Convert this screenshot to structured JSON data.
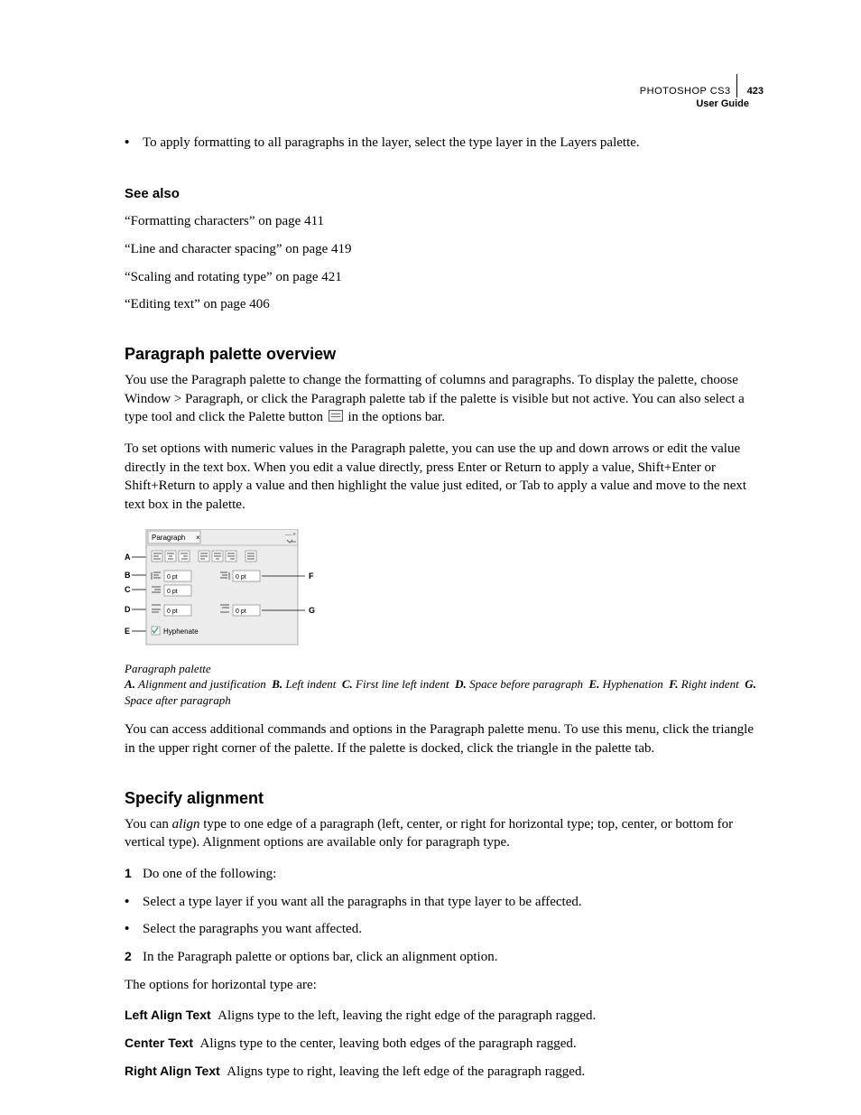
{
  "header": {
    "product": "PHOTOSHOP CS3",
    "page_number": "423",
    "guide": "User Guide"
  },
  "intro_bullet": "To apply formatting to all paragraphs in the layer, select the type layer in the Layers palette.",
  "see_also": {
    "heading": "See also",
    "items": [
      "“Formatting characters” on page 411",
      "“Line and character spacing” on page 419",
      "“Scaling and rotating type” on page 421",
      "“Editing text” on page 406"
    ]
  },
  "overview": {
    "heading": "Paragraph palette overview",
    "p1a": "You use the Paragraph palette to change the formatting of columns and paragraphs. To display the palette, choose Window > Paragraph, or click the Paragraph palette tab if the palette is visible but not active. You can also select a type tool and click the Palette button ",
    "p1b": " in the options bar.",
    "p2": "To set options with numeric values in the Paragraph palette, you can use the up and down arrows or edit the value directly in the text box. When you edit a value directly, press Enter or Return to apply a value, Shift+Enter or Shift+Return to apply a value and then highlight the value just edited, or Tab to apply a value and move to the next text box in the palette."
  },
  "figure": {
    "tab_label": "Paragraph",
    "field_value": "0 pt",
    "hyphenate": "Hyphenate",
    "labels": {
      "A": "A",
      "B": "B",
      "C": "C",
      "D": "D",
      "E": "E",
      "F": "F",
      "G": "G"
    },
    "caption_title": "Paragraph palette",
    "caption_parts": {
      "A": "Alignment and justification",
      "B": "Left indent",
      "C": "First line left indent",
      "D": "Space before paragraph",
      "E": "Hyphenation",
      "F": "Right indent",
      "G": "Space after paragraph"
    }
  },
  "after_figure": "You can access additional commands and options in the Paragraph palette menu. To use this menu, click the triangle in the upper right corner of the palette. If the palette is docked, click the triangle in the palette tab.",
  "specify": {
    "heading": "Specify alignment",
    "p1a": "You can ",
    "p1_em": "align",
    "p1b": " type to one edge of a paragraph (left, center, or right for horizontal type; top, center, or bottom for vertical type). Alignment options are available only for paragraph type.",
    "step1": "Do one of the following:",
    "step1_bullets": [
      "Select a type layer if you want all the paragraphs in that type layer to be affected.",
      "Select the paragraphs you want affected."
    ],
    "step2": "In the Paragraph palette or options bar, click an alignment option.",
    "options_intro": "The options for horizontal type are:",
    "definitions": [
      {
        "term": "Left Align Text",
        "desc": "Aligns type to the left, leaving the right edge of the paragraph ragged."
      },
      {
        "term": "Center Text",
        "desc": "Aligns type to the center, leaving both edges of the paragraph ragged."
      },
      {
        "term": "Right Align Text",
        "desc": "Aligns type to right, leaving the left edge of the paragraph ragged."
      }
    ]
  }
}
